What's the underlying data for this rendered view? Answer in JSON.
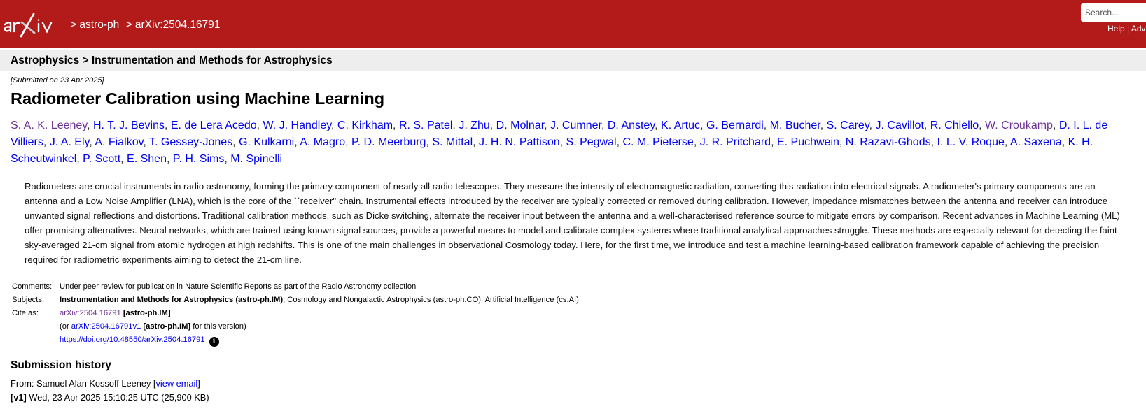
{
  "header": {
    "crumbs": [
      "> astro-ph",
      "> arXiv:2504.16791"
    ],
    "search_placeholder": "Search...",
    "links": [
      "Help",
      "Adv"
    ]
  },
  "subheader": {
    "title": "Astrophysics > Instrumentation and Methods for Astrophysics"
  },
  "paper": {
    "dateline": "[Submitted on 23 Apr 2025]",
    "title": "Radiometer Calibration using Machine Learning",
    "authors": [
      "S. A. K. Leeney",
      "H. T. J. Bevins",
      "E. de Lera Acedo",
      "W. J. Handley",
      "C. Kirkham",
      "R. S. Patel",
      "J. Zhu",
      "D. Molnar",
      "J. Cumner",
      "D. Anstey",
      "K. Artuc",
      "G. Bernardi",
      "M. Bucher",
      "S. Carey",
      "J. Cavillot",
      "R. Chiello",
      "W. Croukamp",
      "D. I. L. de Villiers",
      "J. A. Ely",
      "A. Fialkov",
      "T. Gessey-Jones",
      "G. Kulkarni",
      "A. Magro",
      "P. D. Meerburg",
      "S. Mittal",
      "J. H. N. Pattison",
      "S. Pegwal",
      "C. M. Pieterse",
      "J. R. Pritchard",
      "E. Puchwein",
      "N. Razavi-Ghods",
      "I. L. V. Roque",
      "A. Saxena",
      "K. H. Scheutwinkel",
      "P. Scott",
      "E. Shen",
      "P. H. Sims",
      "M. Spinelli"
    ],
    "visited_authors": [
      "S. A. K. Leeney",
      "W. Croukamp"
    ],
    "abstract": "Radiometers are crucial instruments in radio astronomy, forming the primary component of nearly all radio telescopes. They measure the intensity of electromagnetic radiation, converting this radiation into electrical signals. A radiometer's primary components are an antenna and a Low Noise Amplifier (LNA), which is the core of the ``receiver'' chain. Instrumental effects introduced by the receiver are typically corrected or removed during calibration. However, impedance mismatches between the antenna and receiver can introduce unwanted signal reflections and distortions. Traditional calibration methods, such as Dicke switching, alternate the receiver input between the antenna and a well-characterised reference source to mitigate errors by comparison. Recent advances in Machine Learning (ML) offer promising alternatives. Neural networks, which are trained using known signal sources, provide a powerful means to model and calibrate complex systems where traditional analytical approaches struggle. These methods are especially relevant for detecting the faint sky-averaged 21-cm signal from atomic hydrogen at high redshifts. This is one of the main challenges in observational Cosmology today. Here, for the first time, we introduce and test a machine learning-based calibration framework capable of achieving the precision required for radiometric experiments aiming to detect the 21-cm line."
  },
  "meta": {
    "comments_label": "Comments:",
    "comments": "Under peer review for publication in Nature Scientific Reports as part of the Radio Astronomy collection",
    "subjects_label": "Subjects:",
    "subjects_primary": "Instrumentation and Methods for Astrophysics (astro-ph.IM)",
    "subjects_rest": "; Cosmology and Nongalactic Astrophysics (astro-ph.CO); Artificial Intelligence (cs.AI)",
    "cite_label": "Cite as:",
    "cite_id": "arXiv:2504.16791",
    "cite_cat": "[astro-ph.IM]",
    "cite_or_prefix": "(or ",
    "cite_v1": "arXiv:2504.16791v1",
    "cite_v1_cat": "[astro-ph.IM]",
    "cite_or_suffix": " for this version)",
    "doi": "https://doi.org/10.48550/arXiv.2504.16791"
  },
  "history": {
    "title": "Submission history",
    "from_prefix": "From: Samuel Alan Kossoff Leeney [",
    "view_email": "view email",
    "from_suffix": "]",
    "v1_label": "[v1]",
    "v1_text": " Wed, 23 Apr 2025 15:10:25 UTC (25,900 KB)"
  },
  "colors": {
    "header_bg": "#b31b1b",
    "link": "#0000ee",
    "visited": "#6e3197"
  }
}
